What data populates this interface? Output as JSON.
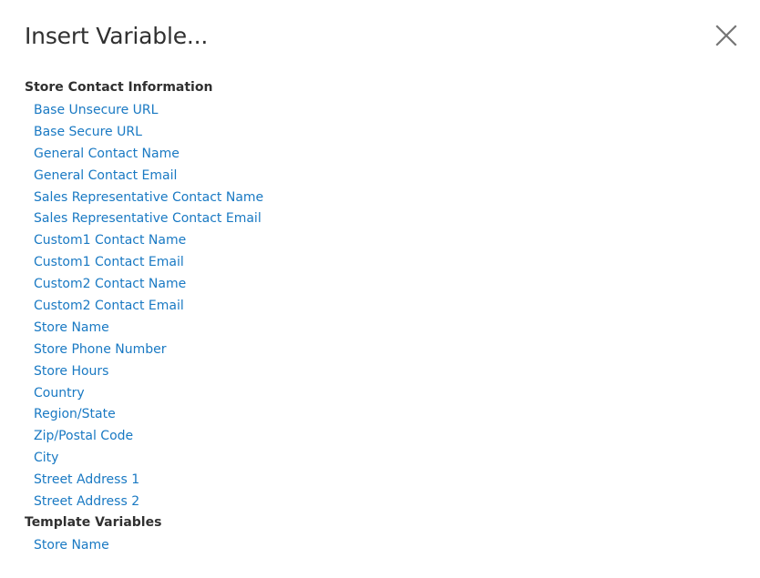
{
  "modal": {
    "title": "Insert Variable..."
  },
  "icons": {
    "close": "close-icon"
  },
  "colors": {
    "link": "#1979c3",
    "heading": "#303030",
    "close_icon": "#757575"
  },
  "groups": [
    {
      "label": "Store Contact Information",
      "items": [
        "Base Unsecure URL",
        "Base Secure URL",
        "General Contact Name",
        "General Contact Email",
        "Sales Representative Contact Name",
        "Sales Representative Contact Email",
        "Custom1 Contact Name",
        "Custom1 Contact Email",
        "Custom2 Contact Name",
        "Custom2 Contact Email",
        "Store Name",
        "Store Phone Number",
        "Store Hours",
        "Country",
        "Region/State",
        "Zip/Postal Code",
        "City",
        "Street Address 1",
        "Street Address 2"
      ]
    },
    {
      "label": "Template Variables",
      "items": [
        "Store Name"
      ]
    }
  ]
}
